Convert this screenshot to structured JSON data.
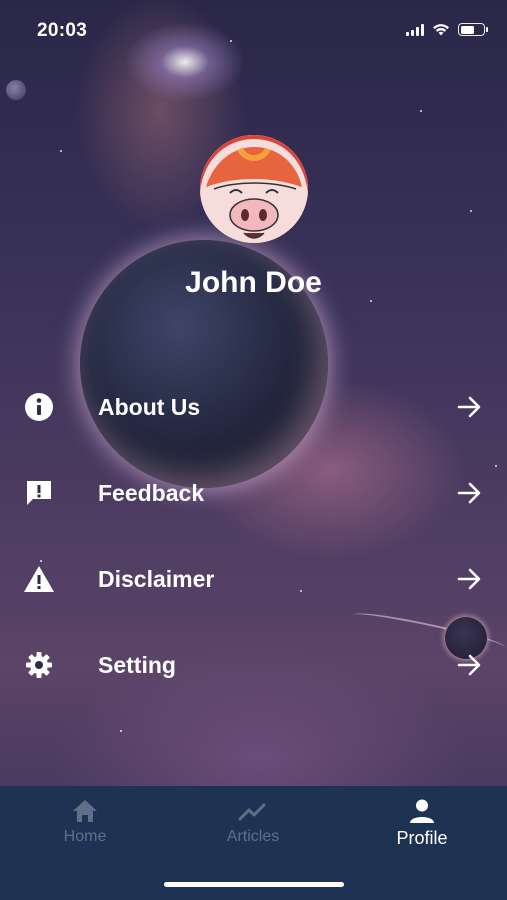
{
  "status_bar": {
    "time": "20:03",
    "icons": [
      "signal-icon",
      "wifi-icon",
      "battery-icon"
    ]
  },
  "profile": {
    "avatar_icon": "pig-avatar",
    "name": "John Doe"
  },
  "menu": {
    "items": [
      {
        "label": "About Us",
        "icon": "info-icon",
        "arrow": "arrow-right-icon"
      },
      {
        "label": "Feedback",
        "icon": "feedback-icon",
        "arrow": "arrow-right-icon"
      },
      {
        "label": "Disclaimer",
        "icon": "warning-icon",
        "arrow": "arrow-right-icon"
      },
      {
        "label": "Setting",
        "icon": "gear-icon",
        "arrow": "arrow-right-icon"
      }
    ]
  },
  "bottom_nav": {
    "items": [
      {
        "label": "Home",
        "icon": "home-icon",
        "active": false
      },
      {
        "label": "Articles",
        "icon": "trending-icon",
        "active": false
      },
      {
        "label": "Profile",
        "icon": "person-icon",
        "active": true
      }
    ]
  },
  "colors": {
    "nav_background": "#1e3353",
    "nav_inactive": "#5f6f88",
    "nav_active": "#ffffff",
    "text": "#ffffff"
  }
}
